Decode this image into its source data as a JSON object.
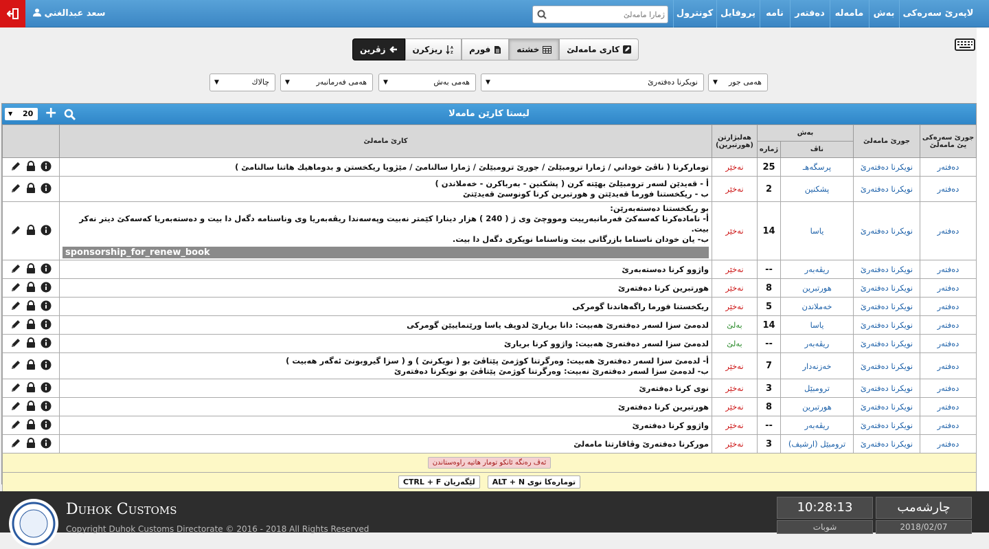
{
  "nav": {
    "user": "سعد عبدالغني",
    "search_placeholder": "ژمارا مامەلێ",
    "items": [
      "لاپەرێ سەرەکی",
      "بەش",
      "مامەلە",
      "دەفتەر",
      "نامە",
      "پروفایل",
      "كونترول"
    ]
  },
  "toolbar": {
    "back": "زڤرین",
    "sort": "ریزکرن",
    "form": "فورم",
    "table": "خشتە",
    "work": "کاری مامەلێ"
  },
  "filters": {
    "kind": "هەمی جور",
    "register": "نویکرنا دەفتەرێ",
    "dept": "هەمی بەش",
    "manager": "هەمی فەرمانبەر",
    "active": "چالاك"
  },
  "panel": {
    "title": "لیستا کارێن مامەلا",
    "page_size": "20"
  },
  "table": {
    "headers": {
      "kind": "جورێ سەرەکی یێ مامەلێ",
      "type": "جورێ مامەلێ",
      "dept": "بەش",
      "name": "ناڤ",
      "count": "ژمارە",
      "choice": "هەلبژارتن (هورتبرین)",
      "work": "کارێ مامەلێ"
    },
    "rows": [
      {
        "kind": "دەفتەر",
        "type": "نویکرنا دەفتەرێ",
        "name": "پرسگەهـ",
        "count": "25",
        "choice": "نەخێر",
        "choice_color": "red",
        "work": [
          "تومارکرنا ( ناڤێ خوداني / ژمارا ترومبێلێ / جورێ ترومبێلێ / ژمارا سالنامێ / مێژویا ریکخستن و بدوماهیك هاتنا سالنامێ )"
        ]
      },
      {
        "kind": "دەفتەر",
        "type": "نویکرنا دەفتەرێ",
        "name": "پشکنین",
        "count": "2",
        "choice": "نەخێر",
        "choice_color": "red",
        "work": [
          "أ - قەیدێن لسەر ترومبێلێ بهێتە کرن ( پشکنین - بەرباکرن - خەملاندن )",
          "ب - ریکخستنا فورما قەیدێتن و هورتبرین کرنا کونوسێ قەیدێتێ"
        ]
      },
      {
        "kind": "دەفتەر",
        "type": "نویکرنا دەفتەرێ",
        "name": "یاسا",
        "count": "14",
        "choice": "نەخێر",
        "choice_color": "red",
        "work": [
          "بو ریکخستنا دەستەبەرێن:",
          "أ- نامادەکرنا کەسەکێ فەرمانبەرییت ومووچێ وی ژ ( 240 ) هزار دینارا کێمتر نەبیت وپەسەندا ریڤەبەریا وی وناسنامە دگەل دا بیت و دەستەبەریا کەسەکێ دیتر نەکر بیت.",
          "ب- یان خودان ناسناما بازرگانی بیت وناسناما نویکری دگەل دا بیت."
        ],
        "tag": "sponsorship_for_renew_book"
      },
      {
        "kind": "دەفتەر",
        "type": "نویکرنا دەفتەرێ",
        "name": "ریڤەبەر",
        "count": "--",
        "choice": "نەخێر",
        "choice_color": "red",
        "work": [
          "واژوو کرنا دەستەبەرێ"
        ]
      },
      {
        "kind": "دەفتەر",
        "type": "نویکرنا دەفتەرێ",
        "name": "هورتبرین",
        "count": "8",
        "choice": "نەخێر",
        "choice_color": "red",
        "work": [
          "هورتبرین کرنا دەفتەرێ"
        ]
      },
      {
        "kind": "دەفتەر",
        "type": "نویکرنا دەفتەرێ",
        "name": "خەملاندن",
        "count": "5",
        "choice": "نەخێر",
        "choice_color": "red",
        "work": [
          "ریکخستنا فورما راگەهاندنا گومرکی"
        ]
      },
      {
        "kind": "دەفتەر",
        "type": "نویکرنا دەفتەرێ",
        "name": "یاسا",
        "count": "14",
        "choice": "بەلێ",
        "choice_color": "green",
        "work": [
          "لدەمێ سزا لسەر دەفتەرێ هەبیت: دانا بریارێ لدویف یاسا ورێنماییێن گومرکی"
        ]
      },
      {
        "kind": "دەفتەر",
        "type": "نویکرنا دەفتەرێ",
        "name": "ریڤەبەر",
        "count": "--",
        "choice": "بەلێ",
        "choice_color": "green",
        "work": [
          "لدەمێ سزا لسەر دەفتەرێ هەبیت: واژوو کرنا بریارێ"
        ]
      },
      {
        "kind": "دەفتەر",
        "type": "نویکرنا دەفتەرێ",
        "name": "خەزنەدار",
        "count": "7",
        "choice": "نەخێر",
        "choice_color": "red",
        "work": [
          "أ- لدەمێ سزا لسەر دەفتەرێ هەبیت: وەرگرتنا کوژمێ پێتاڤێ بو ( نویکرنێ ) و ( سزا گیروبونێ ئەگەر هەبیت )",
          "ب- لدەمێ سزا لسەر دەفتەرێ نەبیت: وەرگرتنا کوژمێ پێتاڤێ بو نویکرنا دەفتەرێ"
        ]
      },
      {
        "kind": "دەفتەر",
        "type": "نویکرنا دەفتەرێ",
        "name": "ترومبێل",
        "count": "3",
        "choice": "نەخێر",
        "choice_color": "red",
        "work": [
          "نوی کرنا دەفتەرێ"
        ]
      },
      {
        "kind": "دەفتەر",
        "type": "نویکرنا دەفتەرێ",
        "name": "هورتبرین",
        "count": "8",
        "choice": "نەخێر",
        "choice_color": "red",
        "work": [
          "هورتبرین کرنا دەفتەرێ"
        ]
      },
      {
        "kind": "دەفتەر",
        "type": "نویکرنا دەفتەرێ",
        "name": "ریڤەبەر",
        "count": "--",
        "choice": "نەخێر",
        "choice_color": "red",
        "work": [
          "واژوو کرنا دەفتەرێ"
        ]
      },
      {
        "kind": "دەفتەر",
        "type": "نویکرنا دەفتەرێ",
        "name": "ترومبێل (ارشیف)",
        "count": "3",
        "choice": "نەخێر",
        "choice_color": "red",
        "work": [
          "مورکرنا دەفتەرێ وڤاقارتنا مامەلێ"
        ]
      }
    ]
  },
  "footer": {
    "note": "ئەڤ رەنگە ئانکو تومار هاتیە راوەستاندن",
    "shortcut_search": "CTRL + F لێگەریان",
    "shortcut_new": "ALT + N تومارەکا نوی"
  },
  "bottom": {
    "brand": "Duhok Customs",
    "copyright": "Copyright Duhok Customs Directorate © 2016 - 2018 All Rights Reserved",
    "time": "10:28:13",
    "day": "چارشەمب",
    "month": "شوبات",
    "date": "2018/02/07"
  },
  "colors": {
    "nav": "#3b86c4",
    "exit": "#d71515",
    "red": "#cc1111",
    "green": "#2a8a2a",
    "link": "#1a5fa8",
    "footer_bg": "#fdf8c6"
  }
}
